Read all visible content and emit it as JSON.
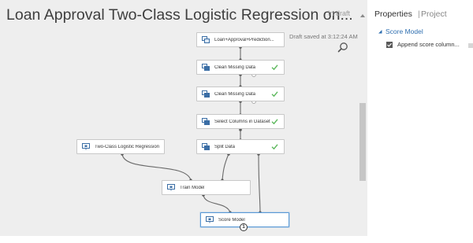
{
  "canvas": {
    "title": "Loan Approval Two-Class Logistic Regression on...",
    "status": "In draft",
    "draft_saved": "Draft saved at 3:12:24 AM"
  },
  "modules": [
    {
      "name": "dataset-module",
      "label": "Loan+Approval+Prediction...",
      "icon": "dataset-icon",
      "completed": false,
      "selected": false
    },
    {
      "name": "clean-missing-data-module-1",
      "label": "Clean Missing Data",
      "icon": "module-icon",
      "completed": true,
      "selected": false
    },
    {
      "name": "clean-missing-data-module-2",
      "label": "Clean Missing Data",
      "icon": "module-icon",
      "completed": true,
      "selected": false
    },
    {
      "name": "select-columns-module",
      "label": "Select Columns in Dataset",
      "icon": "module-icon",
      "completed": true,
      "selected": false
    },
    {
      "name": "split-data-module",
      "label": "Split Data",
      "icon": "module-icon",
      "completed": true,
      "selected": false
    },
    {
      "name": "two-class-logistic-regression-module",
      "label": "Two-Class Logistic Regression",
      "icon": "model-icon",
      "completed": false,
      "selected": false
    },
    {
      "name": "train-model-module",
      "label": "Train Model",
      "icon": "model-icon",
      "completed": false,
      "selected": false
    },
    {
      "name": "score-model-module",
      "label": "Score Model",
      "icon": "model-icon",
      "completed": false,
      "selected": true
    }
  ],
  "score_badge": "1",
  "properties": {
    "tab_active": "Properties",
    "separator": "|",
    "tab_inactive": "Project",
    "section": "Score Model",
    "param_label": "Append score column...",
    "param_checked": true
  },
  "colors": {
    "canvas_bg": "#eeeeee",
    "accent_blue": "#2f6fb0",
    "check_green": "#5cb85c",
    "selected_border": "#5a9ad6"
  }
}
